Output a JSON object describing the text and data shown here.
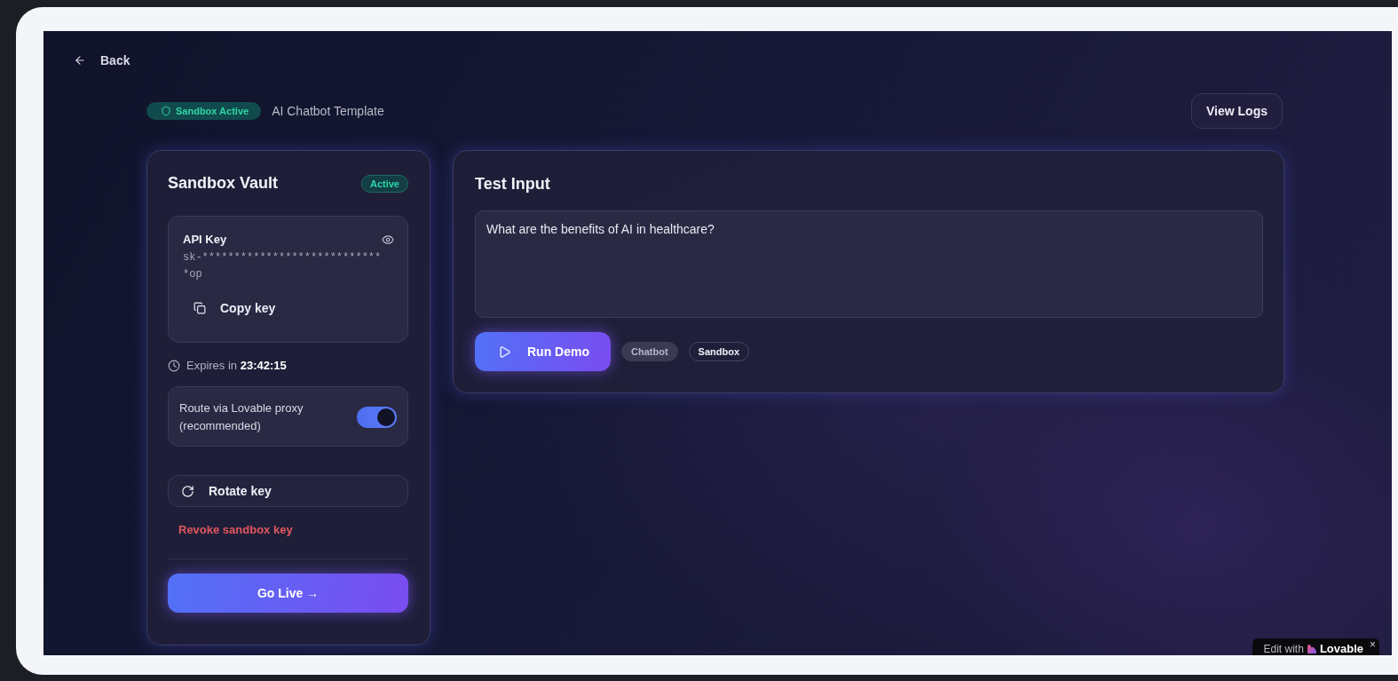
{
  "back": {
    "label": "Back"
  },
  "header": {
    "status_badge": "Sandbox Active",
    "title": "AI Chatbot Template",
    "view_logs": "View Logs"
  },
  "vault": {
    "title": "Sandbox Vault",
    "status": "Active",
    "api_key": {
      "label": "API Key",
      "value": "sk-*****************************op",
      "copy": "Copy key"
    },
    "expires": "Expires in **23:42:15**",
    "proxy": {
      "label": "Route via Lovable proxy (recommended)",
      "on": true
    },
    "rotate": "Rotate key",
    "revoke": "Revoke sandbox key",
    "go_live": "Go Live →"
  },
  "test": {
    "title": "Test Input",
    "value": "What are the benefits of AI in healthcare?",
    "run": "Run Demo",
    "tags": [
      {
        "label": "Chatbot",
        "kind": "filled"
      },
      {
        "label": "Sandbox",
        "kind": "outline"
      }
    ]
  },
  "lovable_badge": {
    "prefix": "Edit with",
    "brand": "Lovable",
    "close": "×"
  }
}
